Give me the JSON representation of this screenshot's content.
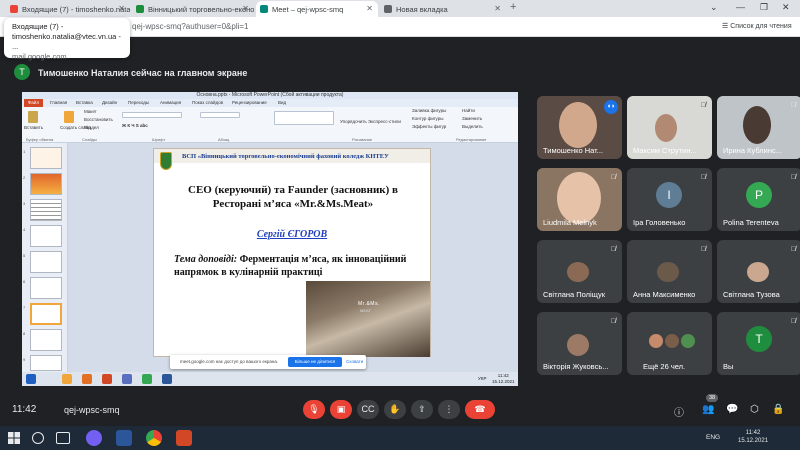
{
  "browser": {
    "tabs": [
      {
        "label": "Входящие (7) - timoshenko.natalia@",
        "favicon_color": "#ea4335"
      },
      {
        "label": "Вінницький торговельно-економ",
        "favicon_color": "#1e8e3e"
      },
      {
        "label": "Meet – qej-wpsc-smq",
        "favicon_color": "#00897b",
        "active": true
      },
      {
        "label": "Новая вкладка",
        "favicon_color": "#5f6368"
      }
    ],
    "url": "qej-wpsc-smq?authuser=0&pli=1",
    "clear_list": "Список для чтения",
    "tooltip": {
      "title": "Входящие (7) -",
      "email": "timoshenko.natalia@vtec.vn.ua - ...",
      "domain": "mail.google.com"
    }
  },
  "meet": {
    "presenter_avatar_letter": "T",
    "banner": "Тимошенко Наталия сейчас на главном экране",
    "time": "11:42",
    "code": "qej-wpsc-smq",
    "participant_count": "38",
    "participants": [
      {
        "name": "Тимошенко Нат...",
        "type": "video",
        "speaking": true
      },
      {
        "name": "Максим Струтин...",
        "type": "video"
      },
      {
        "name": "Ирина Кублинс...",
        "type": "video"
      },
      {
        "name": "Liudmila Melnyk",
        "type": "video"
      },
      {
        "name": "Іра Головенько",
        "type": "avatar",
        "letter": "І",
        "color": "#5f7d95"
      },
      {
        "name": "Polina Terenteva",
        "type": "avatar",
        "letter": "P",
        "color": "#34a853"
      },
      {
        "name": "Світлана Поліщук",
        "type": "video"
      },
      {
        "name": "Анна Максименко",
        "type": "video"
      },
      {
        "name": "Світлана Тузова",
        "type": "video"
      },
      {
        "name": "Вікторія Жуковсь...",
        "type": "video"
      },
      {
        "name": "Ещё 26 чел.",
        "type": "more"
      },
      {
        "name": "Вы",
        "type": "avatar",
        "letter": "T",
        "color": "#1e8e3e"
      }
    ]
  },
  "ppt": {
    "window_title": "Основна.pptx - Microsoft PowerPoint (Сбой активации продукта)",
    "ribbon_tabs": [
      "Файл",
      "Главная",
      "Вставка",
      "Дизайн",
      "Переходы",
      "Анимация",
      "Показ слайдов",
      "Рецензирование",
      "Вид"
    ],
    "ribbon": {
      "paste": "Вставить",
      "new_slide": "Создать слайд",
      "layout": "Макет",
      "restore": "Восстановить",
      "section": "Раздел",
      "arrange": "Упорядочить",
      "quick_styles": "Экспресс-стили",
      "shape_fill": "Заливка фигуры",
      "shape_outline": "Контур фигуры",
      "shape_effects": "Эффекты фигур",
      "find": "Найти",
      "replace": "Заменить",
      "select": "Выделить",
      "groups": [
        "Буфер обмена",
        "Слайды",
        "Шрифт",
        "Абзац",
        "Рисование",
        "Редактирование"
      ]
    },
    "slide": {
      "header": "ВСП «Вінницький торговельно-економічний фаховий коледж КНТЕУ",
      "title": "СЕО (керуючий) та Faunder (засновник) в Ресторані м’яса «Mr.&Ms.Meat»",
      "author": "Сергій ЄГОРОВ",
      "topic_label": "Тема доповіді:",
      "topic": " Ферментація м’яса, як інноваційний напрямок в кулінарній практиці",
      "photo_sign": "Mr.&Ms.",
      "photo_sign2": "MEAT"
    },
    "status": {
      "slide": "Слайд 7 из 12",
      "theme": "\"Тема Office\"",
      "lang": "украинский"
    },
    "share": {
      "text": "meet.google.com нає доступ до вашого екрана.",
      "stop": "Більше не ділитися",
      "hide": "Сховати"
    },
    "inner_clock": {
      "time": "11:42",
      "date": "15.12.2021"
    },
    "inner_lang": "УКР"
  },
  "windows": {
    "lang": "ENG",
    "time": "11:42",
    "date": "15.12.2021"
  }
}
